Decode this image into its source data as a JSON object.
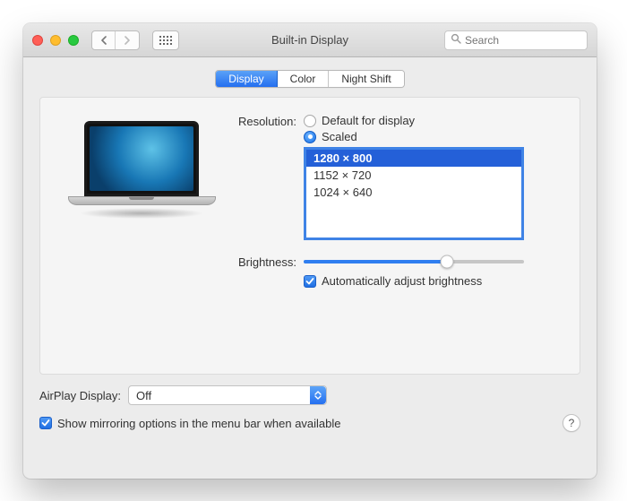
{
  "titlebar": {
    "title": "Built-in Display",
    "search_placeholder": "Search"
  },
  "tabs": {
    "items": [
      "Display",
      "Color",
      "Night Shift"
    ],
    "active_index": 0
  },
  "resolution": {
    "label": "Resolution:",
    "default_label": "Default for display",
    "scaled_label": "Scaled",
    "selected": "scaled",
    "options": [
      "1280 × 800",
      "1152 × 720",
      "1024 × 640"
    ],
    "selected_option_index": 0
  },
  "brightness": {
    "label": "Brightness:",
    "value_percent": 65,
    "auto_label": "Automatically adjust brightness",
    "auto_checked": true
  },
  "airplay": {
    "label": "AirPlay Display:",
    "value": "Off"
  },
  "mirroring": {
    "label": "Show mirroring options in the menu bar when available",
    "checked": true
  },
  "help_label": "?"
}
